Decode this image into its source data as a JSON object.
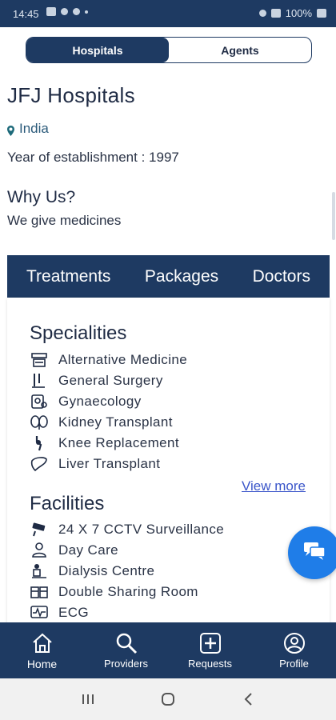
{
  "status_bar": {
    "time": "14:45",
    "battery": "100%"
  },
  "segment": {
    "hospitals": "Hospitals",
    "agents": "Agents"
  },
  "hospital": {
    "name": "JFJ Hospitals",
    "location": "India",
    "year": "Year of establishment : 1997",
    "why_title": "Why Us?",
    "why_text": "We give medicines"
  },
  "subtabs": {
    "treatments": "Treatments",
    "packages": "Packages",
    "doctors": "Doctors"
  },
  "specialities": {
    "title": "Specialities",
    "items": [
      {
        "label": "Alternative Medicine",
        "icon": "medicine-icon"
      },
      {
        "label": "General Surgery",
        "icon": "surgery-icon"
      },
      {
        "label": "Gynaecology",
        "icon": "gynaecology-icon"
      },
      {
        "label": "Kidney Transplant",
        "icon": "kidney-icon"
      },
      {
        "label": "Knee Replacement",
        "icon": "knee-icon"
      },
      {
        "label": "Liver Transplant",
        "icon": "liver-icon"
      }
    ],
    "view_more": "View more"
  },
  "facilities": {
    "title": "Facilities",
    "items": [
      {
        "label": "24 X 7 CCTV Surveillance",
        "icon": "cctv-icon"
      },
      {
        "label": "Day Care",
        "icon": "day-care-icon"
      },
      {
        "label": "Dialysis Centre",
        "icon": "dialysis-icon"
      },
      {
        "label": "Double Sharing Room",
        "icon": "room-icon"
      },
      {
        "label": "ECG",
        "icon": "ecg-icon"
      }
    ]
  },
  "bottom_nav": {
    "home": "Home",
    "providers": "Providers",
    "requests": "Requests",
    "profile": "Profile"
  },
  "colors": {
    "primary": "#1e3a62",
    "fab": "#1f7de8",
    "link": "#3a55c9"
  }
}
